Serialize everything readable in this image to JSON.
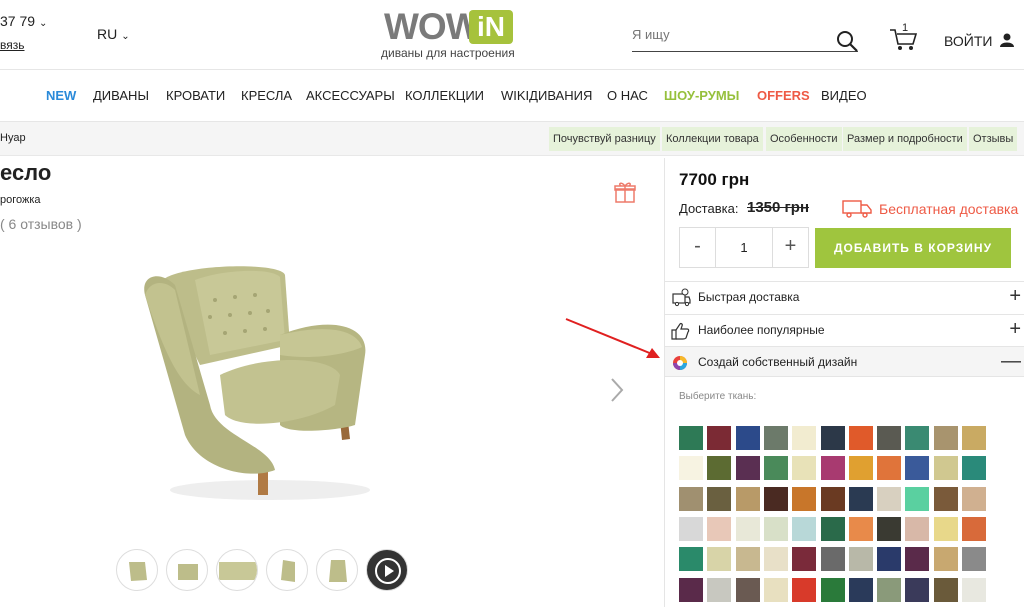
{
  "header": {
    "phone": "37 79",
    "callback": "вязь",
    "lang": "RU",
    "logo_wow": "WOW",
    "logo_in": "iN",
    "slogan": "диваны для настроения",
    "search_placeholder": "Я ищу",
    "cart_count": "1",
    "login": "ВОЙТИ"
  },
  "nav": {
    "items": [
      "NEW",
      "ДИВАНЫ",
      "КРОВАТИ",
      "КРЕСЛА",
      "АКСЕССУАРЫ",
      "КОЛЛЕКЦИИ",
      "WIKIДИВАНИЯ",
      "О НАС",
      "ШОУ-РУМЫ",
      "OFFERS",
      "ВИДЕО"
    ]
  },
  "subbar": {
    "crumb": "Нуар",
    "anchors": [
      "Почувствуй разницу",
      "Коллекции товара",
      "Особенности",
      "Размер и подробности",
      "Отзывы"
    ]
  },
  "product": {
    "title": "есло",
    "material": "рогожка",
    "reviews": "( 6 отзывов )"
  },
  "panel": {
    "price": "7700 грн",
    "delivery_label": "Доставка:",
    "delivery_old": "1350 грн",
    "free_delivery": "Бесплатная доставка",
    "qty_minus": "-",
    "qty_value": "1",
    "qty_plus": "+",
    "add_to_cart": "ДОБАВИТЬ В КОРЗИНУ",
    "accordion": [
      {
        "label": "Быстрая доставка",
        "toggle": "+"
      },
      {
        "label": "Наиболее популярные",
        "toggle": "+"
      },
      {
        "label": "Создай собственный дизайн",
        "toggle": "—"
      }
    ],
    "fabric_label": "Выберите ткань:"
  },
  "swatch_colors": [
    [
      "#2e7a56",
      "#7b2a34",
      "#2c4a8a",
      "#6c7a6a",
      "#f2ecd0",
      "#2c3848",
      "#e05a2a",
      "#5a5a52",
      "#3a8a72",
      "#a8946e",
      "#c9aa63"
    ],
    [
      "#f7f3e2",
      "#5c6b32",
      "#5a2f52",
      "#4a8a5a",
      "#e8e2b8",
      "#a83a70",
      "#e0a030",
      "#e0743a",
      "#3a5a9a",
      "#d0c890",
      "#2a8a7a"
    ],
    [
      "#a09070",
      "#6a6040",
      "#b89a68",
      "#4a2a22",
      "#c8762a",
      "#6a3a22",
      "#2a3a52",
      "#d8d0c0",
      "#5ad0a0",
      "#7a5a3a",
      "#d0b090"
    ],
    [
      "#d8d8d8",
      "#e8c8b8",
      "#e8e8d8",
      "#d8e0c8",
      "#b8d8d8",
      "#2a6a4a",
      "#e88a4a",
      "#3a3a32",
      "#d8b8a8",
      "#e8d88a",
      "#d86a3a"
    ],
    [
      "#2a8a6a",
      "#d8d4a8",
      "#c8b890",
      "#e8e0c8",
      "#7a2a3a",
      "#6a6a6a",
      "#b8b8a8",
      "#2a3a6a",
      "#5a2a4a",
      "#c8a870",
      "#8a8a8a"
    ],
    [
      "#5a2a4a",
      "#c8c8c0",
      "#6a5a52",
      "#e8e0c0",
      "#d83a2a",
      "#2a7a3a",
      "#2a3a5a",
      "#8a9a7a",
      "#3a3a5a",
      "#6a5a3a",
      "#e8e8e0"
    ]
  ]
}
